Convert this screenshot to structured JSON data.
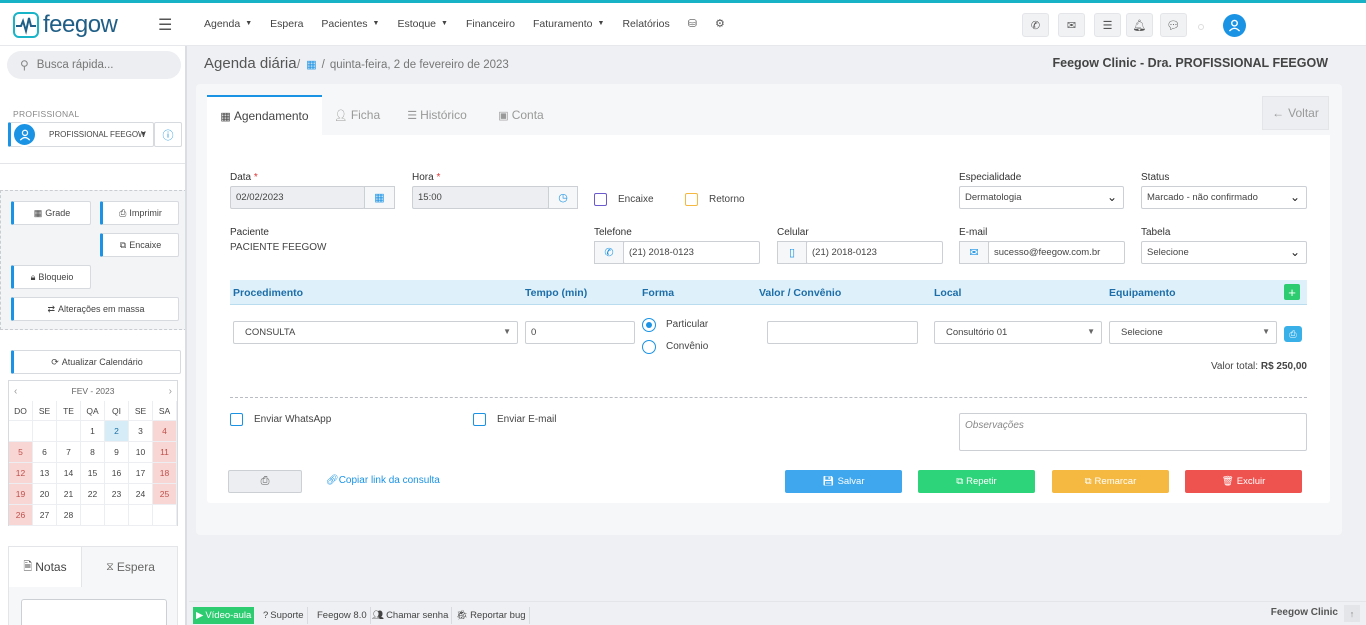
{
  "app": {
    "logo_text": "feegow"
  },
  "nav": {
    "items": [
      {
        "label": "Agenda",
        "caret": true
      },
      {
        "label": "Espera",
        "caret": false
      },
      {
        "label": "Pacientes",
        "caret": true
      },
      {
        "label": "Estoque",
        "caret": true
      },
      {
        "label": "Financeiro",
        "caret": false
      },
      {
        "label": "Faturamento",
        "caret": true
      },
      {
        "label": "Relatórios",
        "caret": false
      }
    ]
  },
  "sidebar": {
    "search_placeholder": "Busca rápida...",
    "profissional_label": "PROFISSIONAL",
    "profissional_value": "PROFISSIONAL FEEGOW",
    "buttons": {
      "grade": "Grade",
      "imprimir": "Imprimir",
      "encaixe": "Encaixe",
      "bloqueio": "Bloqueio",
      "alteracoes": "Alterações em massa",
      "atualizar": "Atualizar Calendário"
    },
    "calendar": {
      "month": "FEV - 2023",
      "dow": [
        "DO",
        "SE",
        "TE",
        "QA",
        "QI",
        "SE",
        "SA"
      ],
      "weeks": [
        [
          "",
          "",
          "",
          "1",
          "2",
          "3",
          "4"
        ],
        [
          "5",
          "6",
          "7",
          "8",
          "9",
          "10",
          "11"
        ],
        [
          "12",
          "13",
          "14",
          "15",
          "16",
          "17",
          "18"
        ],
        [
          "19",
          "20",
          "21",
          "22",
          "23",
          "24",
          "25"
        ],
        [
          "26",
          "27",
          "28",
          "",
          "",
          "",
          ""
        ]
      ],
      "today": "2"
    },
    "tabs": {
      "notas": "Notas",
      "espera": "Espera"
    }
  },
  "header": {
    "title": "Agenda diária",
    "separator": "/",
    "date": "quinta-feira, 2 de fevereiro de 2023",
    "clinic": "Feegow Clinic - Dra. PROFISSIONAL FEEGOW"
  },
  "tabs": {
    "agendamento": "Agendamento",
    "ficha": "Ficha",
    "historico": "Histórico",
    "conta": "Conta",
    "voltar": "Voltar"
  },
  "form": {
    "data_label": "Data",
    "data_value": "02/02/2023",
    "hora_label": "Hora",
    "hora_value": "15:00",
    "required_mark": "*",
    "encaixe": "Encaixe",
    "retorno": "Retorno",
    "especialidade_label": "Especialidade",
    "especialidade_value": "Dermatologia",
    "status_label": "Status",
    "status_value": "Marcado - não confirmado",
    "paciente_label": "Paciente",
    "paciente_value": "PACIENTE FEEGOW",
    "telefone_label": "Telefone",
    "telefone_value": "(21) 2018-0123",
    "celular_label": "Celular",
    "celular_value": "(21) 2018-0123",
    "email_label": "E-mail",
    "email_value": "sucesso@feegow.com.br",
    "tabela_label": "Tabela",
    "tabela_value": "Selecione"
  },
  "procedure": {
    "headers": {
      "procedimento": "Procedimento",
      "tempo": "Tempo (min)",
      "forma": "Forma",
      "valor": "Valor / Convênio",
      "local": "Local",
      "equipamento": "Equipamento"
    },
    "row": {
      "procedimento": "CONSULTA",
      "tempo": "0",
      "forma_particular": "Particular",
      "forma_convenio": "Convênio",
      "valor": "",
      "local": "Consultório 01",
      "equipamento": "Selecione"
    },
    "total_label": "Valor total:",
    "total_value": "R$ 250,00"
  },
  "options": {
    "whatsapp": "Enviar WhatsApp",
    "email": "Enviar E-mail",
    "obs_placeholder": "Observações"
  },
  "actions": {
    "copy_link": "Copiar link da consulta",
    "salvar": "Salvar",
    "repetir": "Repetir",
    "remarcar": "Remarcar",
    "excluir": "Excluir"
  },
  "colors": {
    "salvar": "#3ea7ee",
    "repetir": "#2ed47a",
    "remarcar": "#f5b942",
    "excluir": "#ef5350"
  },
  "footer": {
    "video": "Vídeo-aula",
    "suporte": "Suporte",
    "versao": "Feegow 8.0",
    "chamar": "Chamar senha",
    "bug": "Reportar bug",
    "brand": "Feegow Clinic"
  }
}
